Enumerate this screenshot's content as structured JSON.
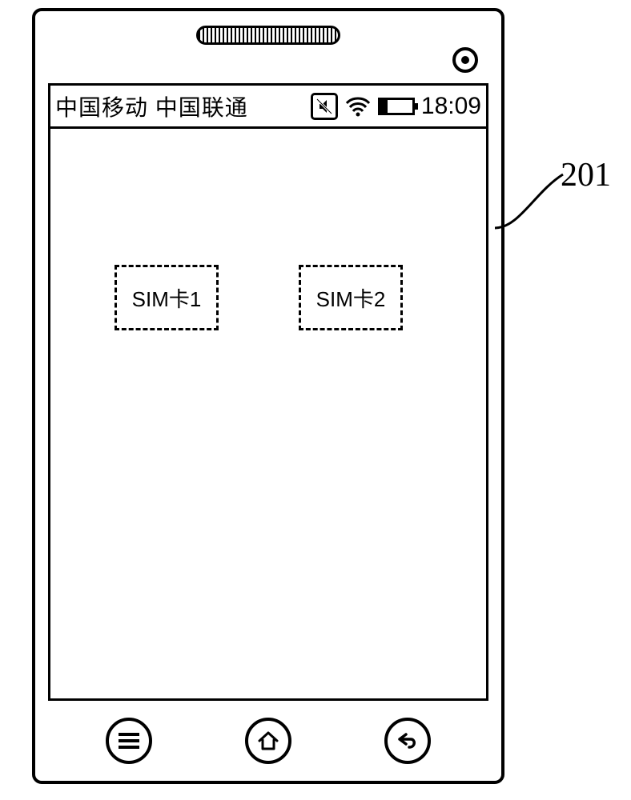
{
  "statusbar": {
    "carrier1": "中国移动",
    "carrier2": "中国联通",
    "time": "18:09",
    "muted_glyph": "✕"
  },
  "content": {
    "sim1": "SIM卡1",
    "sim2": "SIM卡2"
  },
  "callout": {
    "label": "201"
  }
}
